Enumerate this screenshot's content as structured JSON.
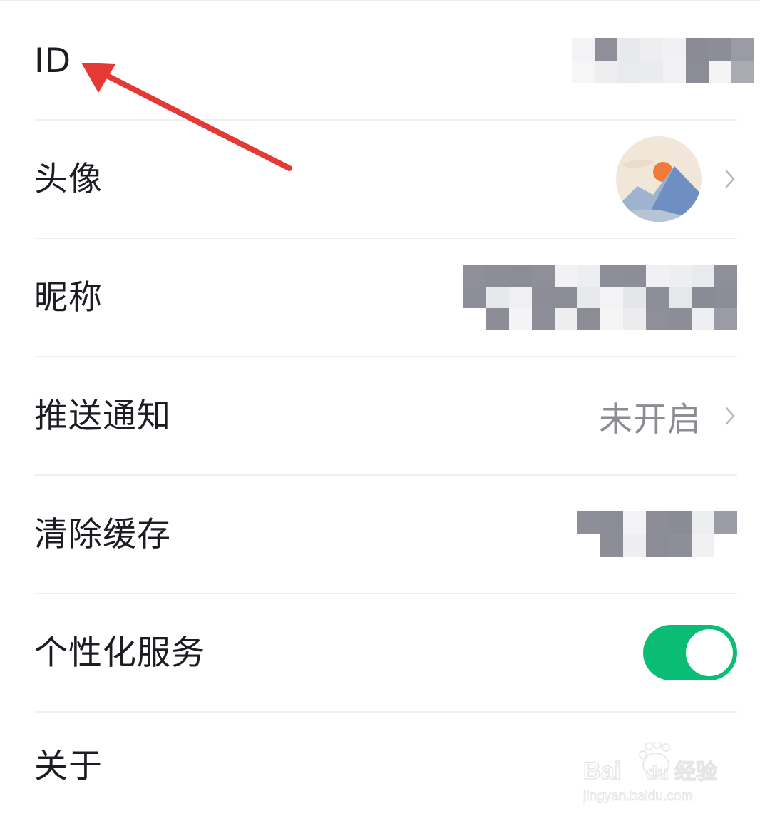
{
  "settings": {
    "rows": [
      {
        "label": "ID",
        "value_obscured": true
      },
      {
        "label": "头像",
        "avatar": "landscape-avatar"
      },
      {
        "label": "昵称",
        "value_obscured": true
      },
      {
        "label": "推送通知",
        "value": "未开启"
      },
      {
        "label": "清除缓存",
        "value_obscured": true
      },
      {
        "label": "个性化服务",
        "toggle_on": true
      },
      {
        "label": "关于"
      }
    ]
  },
  "annotation": {
    "arrow_color": "#e53935",
    "points_to": "ID"
  },
  "colors": {
    "toggle_on": "#0bbc74",
    "label_text": "#1c1c22",
    "secondary_text": "#8c8c92",
    "divider": "#f0f0f0"
  },
  "icons": {
    "chevron": "chevron-right-icon",
    "arrow": "red-arrow-annotation"
  },
  "watermark": {
    "brand": "Bai du 经验",
    "url": "jingyan.baidu.com"
  }
}
